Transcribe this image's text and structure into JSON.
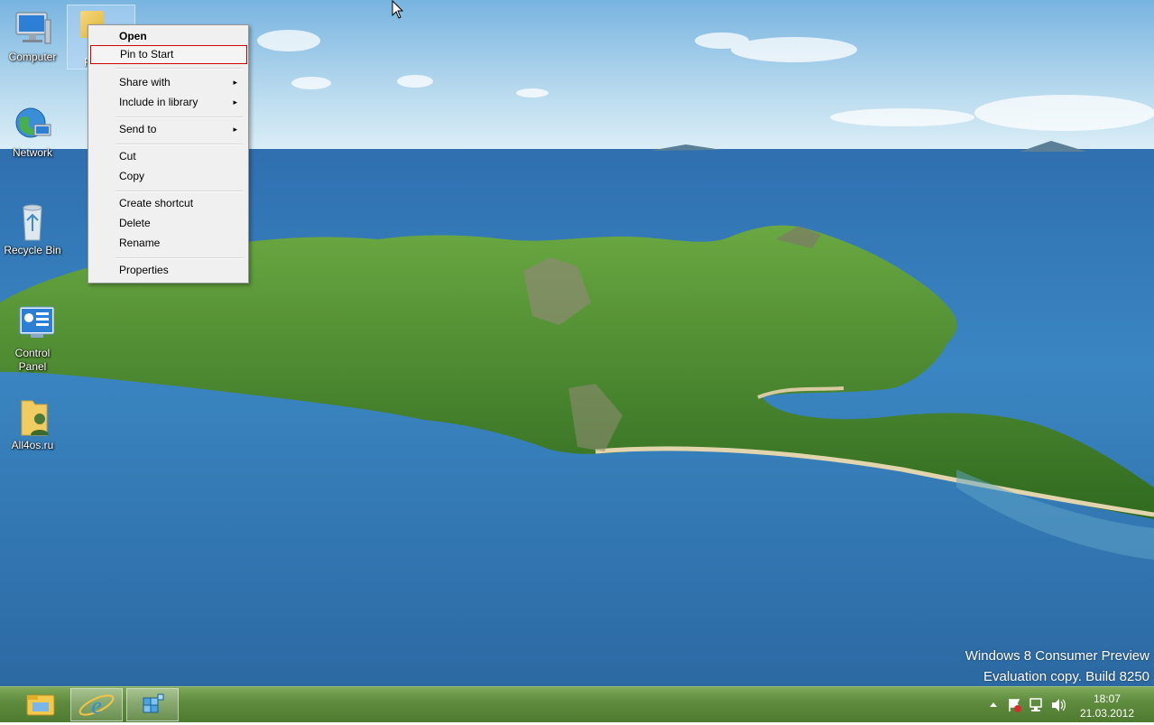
{
  "desktop": {
    "icons": [
      {
        "label": "Computer",
        "icon": "computer-icon"
      },
      {
        "label": "Network",
        "icon": "network-icon"
      },
      {
        "label": "Recycle Bin",
        "icon": "recycle-bin-icon"
      },
      {
        "label": "Control Panel",
        "icon": "control-panel-icon"
      },
      {
        "label": "All4os.ru",
        "icon": "user-folder-icon"
      }
    ],
    "selected_icon_label_fragment": "F",
    "selected_icon": "folder-icon"
  },
  "context_menu": {
    "items": [
      {
        "label": "Open"
      },
      {
        "label": "Pin to Start"
      },
      {
        "label": "Share with"
      },
      {
        "label": "Include in library"
      },
      {
        "label": "Send to"
      },
      {
        "label": "Cut"
      },
      {
        "label": "Copy"
      },
      {
        "label": "Create shortcut"
      },
      {
        "label": "Delete"
      },
      {
        "label": "Rename"
      },
      {
        "label": "Properties"
      }
    ],
    "arrow": "▸",
    "highlight_color": "#cc0000"
  },
  "watermark": {
    "line1": "Windows 8 Consumer Preview",
    "line2": "Evaluation copy. Build 8250"
  },
  "taskbar": {
    "buttons": [
      {
        "icon": "file-explorer-icon"
      },
      {
        "icon": "internet-explorer-icon"
      },
      {
        "icon": "app-icon"
      }
    ],
    "tray": {
      "icons": [
        "show-hidden-icons-arrow",
        "action-center-flag-icon",
        "network-tray-icon",
        "volume-icon"
      ],
      "time": "18:07",
      "date": "21.03.2012"
    }
  }
}
